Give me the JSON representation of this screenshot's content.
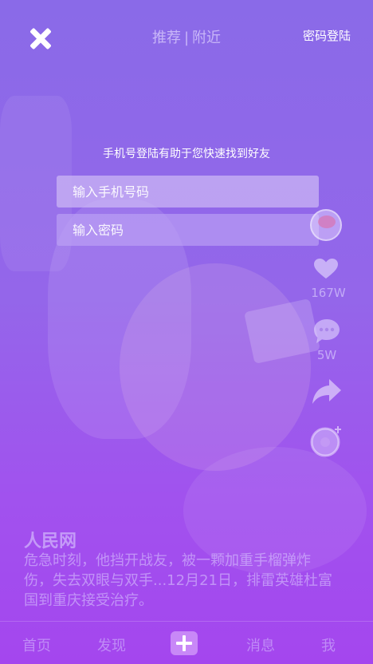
{
  "top_bar": {
    "tab_recommend": "推荐",
    "tab_separator": "|",
    "tab_nearby": "附近",
    "password_login": "密码登陆"
  },
  "login": {
    "hint": "手机号登陆有助于您快速找到好友",
    "phone_placeholder": "输入手机号码",
    "password_placeholder": "输入密码"
  },
  "actions": {
    "like_count": "167W",
    "comment_count": "5W"
  },
  "post": {
    "author": "人民网",
    "caption": "危急时刻，他挡开战友，被一颗加重手榴弹炸伤，失去双眼与双手...12月21日，排雷英雄杜富国到重庆接受治疗。"
  },
  "nav": {
    "home": "首页",
    "discover": "发现",
    "messages": "消息",
    "me": "我"
  },
  "colors": {
    "gradient_top": "#8a6ae8",
    "gradient_bottom": "#a446ee"
  },
  "icons": [
    "close-icon",
    "heart-icon",
    "comment-icon",
    "share-icon",
    "music-disc-icon",
    "plus-icon"
  ]
}
